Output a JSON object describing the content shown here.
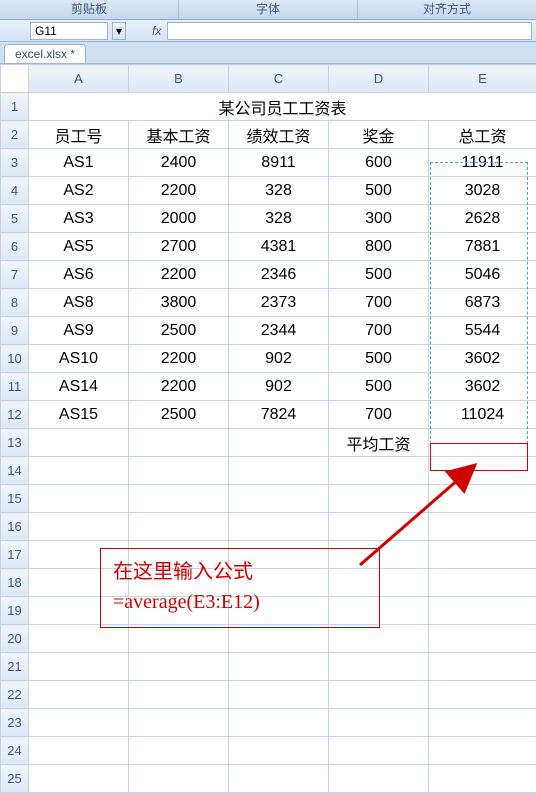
{
  "ribbon": {
    "groups": [
      "剪贴板",
      "字体",
      "对齐方式"
    ],
    "dropdown_glyph": "▾"
  },
  "namebox": {
    "cell": "G11",
    "fx": "fx"
  },
  "tab": {
    "label": "excel.xlsx *"
  },
  "columns": [
    "A",
    "B",
    "C",
    "D",
    "E"
  ],
  "row_numbers": [
    "1",
    "2",
    "3",
    "4",
    "5",
    "6",
    "7",
    "8",
    "9",
    "10",
    "11",
    "12",
    "13",
    "14",
    "15",
    "16",
    "17",
    "18",
    "19",
    "20",
    "21",
    "22",
    "23",
    "24",
    "25"
  ],
  "title": "某公司员工工资表",
  "headers": {
    "a": "员工号",
    "b": "基本工资",
    "c": "绩效工资",
    "d": "奖金",
    "e": "总工资"
  },
  "rows": [
    {
      "a": "AS1",
      "b": "2400",
      "c": "8911",
      "d": "600",
      "e": "11911"
    },
    {
      "a": "AS2",
      "b": "2200",
      "c": "328",
      "d": "500",
      "e": "3028"
    },
    {
      "a": "AS3",
      "b": "2000",
      "c": "328",
      "d": "300",
      "e": "2628"
    },
    {
      "a": "AS5",
      "b": "2700",
      "c": "4381",
      "d": "800",
      "e": "7881"
    },
    {
      "a": "AS6",
      "b": "2200",
      "c": "2346",
      "d": "500",
      "e": "5046"
    },
    {
      "a": "AS8",
      "b": "3800",
      "c": "2373",
      "d": "700",
      "e": "6873"
    },
    {
      "a": "AS9",
      "b": "2500",
      "c": "2344",
      "d": "700",
      "e": "5544"
    },
    {
      "a": "AS10",
      "b": "2200",
      "c": "902",
      "d": "500",
      "e": "3602"
    },
    {
      "a": "AS14",
      "b": "2200",
      "c": "902",
      "d": "500",
      "e": "3602"
    },
    {
      "a": "AS15",
      "b": "2500",
      "c": "7824",
      "d": "700",
      "e": "11024"
    }
  ],
  "avg_label": "平均工资",
  "annotation": {
    "line1": "在这里输入公式",
    "line2": "=average(E3:E12)"
  },
  "chart_data": {
    "type": "table",
    "title": "某公司员工工资表",
    "columns": [
      "员工号",
      "基本工资",
      "绩效工资",
      "奖金",
      "总工资"
    ],
    "rows": [
      [
        "AS1",
        2400,
        8911,
        600,
        11911
      ],
      [
        "AS2",
        2200,
        328,
        500,
        3028
      ],
      [
        "AS3",
        2000,
        328,
        300,
        2628
      ],
      [
        "AS5",
        2700,
        4381,
        800,
        7881
      ],
      [
        "AS6",
        2200,
        2346,
        500,
        5046
      ],
      [
        "AS8",
        3800,
        2373,
        700,
        6873
      ],
      [
        "AS9",
        2500,
        2344,
        700,
        5544
      ],
      [
        "AS10",
        2200,
        902,
        500,
        3602
      ],
      [
        "AS14",
        2200,
        902,
        500,
        3602
      ],
      [
        "AS15",
        2500,
        7824,
        700,
        11024
      ]
    ],
    "summary_row": [
      "平均工资",
      "=average(E3:E12)"
    ]
  }
}
